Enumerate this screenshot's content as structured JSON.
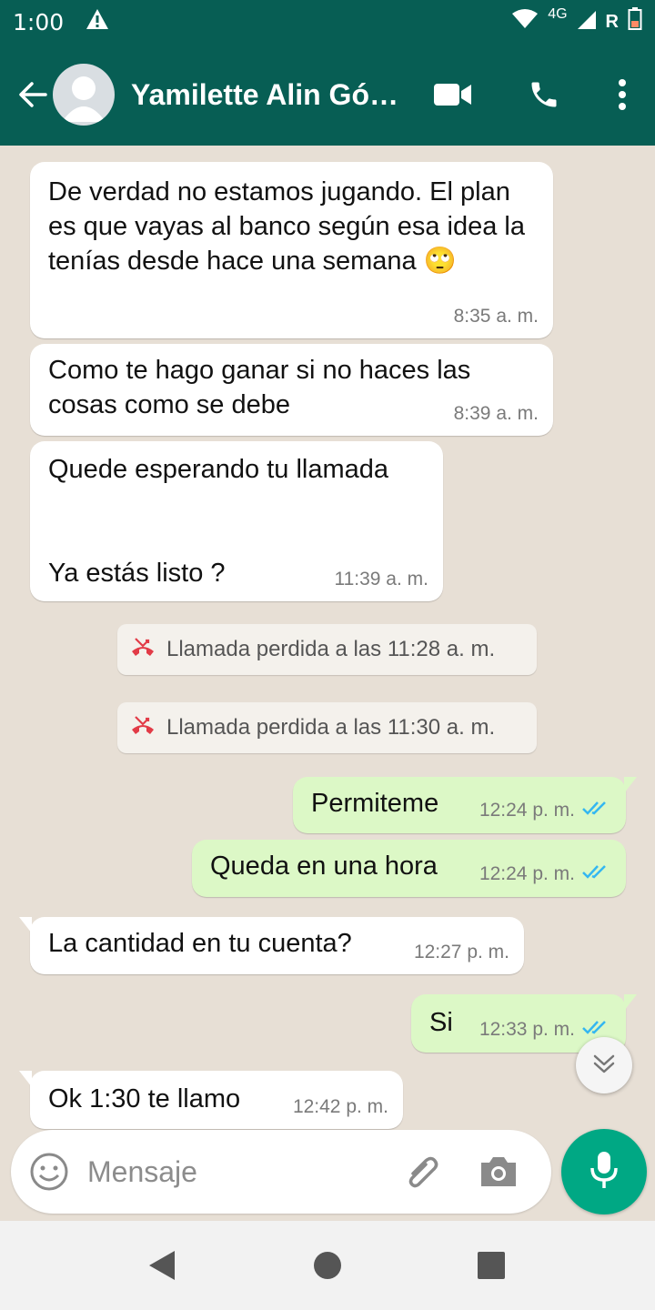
{
  "status_bar": {
    "time": "1:00",
    "network": "4G",
    "roaming": "R",
    "icons": [
      "warning-icon",
      "wifi-icon",
      "signal-icon",
      "battery-icon"
    ]
  },
  "header": {
    "contact_name": "Yamilette Alin Gó…",
    "icons": [
      "back-arrow-icon",
      "avatar",
      "video-call-icon",
      "voice-call-icon",
      "more-options-icon"
    ]
  },
  "messages": [
    {
      "direction": "in",
      "text": "De verdad no estamos jugando. El plan es que vayas al banco según esa idea la tenías desde hace una semana 🙄",
      "time": "8:35 a. m."
    },
    {
      "direction": "in",
      "text": "Como te hago ganar si no haces las cosas como se debe",
      "time": "8:39 a. m."
    },
    {
      "direction": "in",
      "text": "Quede esperando tu llamada\n\n\nYa estás listo ?",
      "time": "11:39 a. m."
    },
    {
      "direction": "system",
      "icon": "missed-call-icon",
      "text": "Llamada perdida a las 11:28 a. m."
    },
    {
      "direction": "system",
      "icon": "missed-call-icon",
      "text": "Llamada perdida a las 11:30 a. m."
    },
    {
      "direction": "out",
      "text": "Permiteme",
      "time": "12:24 p. m.",
      "status": "read"
    },
    {
      "direction": "out",
      "text": "Queda en una hora",
      "time": "12:24 p. m.",
      "status": "read"
    },
    {
      "direction": "in",
      "text": "La cantidad en tu cuenta?",
      "time": "12:27 p. m."
    },
    {
      "direction": "out",
      "text": "Si",
      "time": "12:33 p. m.",
      "status": "read"
    },
    {
      "direction": "in",
      "text": "Ok 1:30 te llamo",
      "time": "12:42 p. m."
    }
  ],
  "composer": {
    "placeholder": "Mensaje",
    "icons": [
      "emoji-icon",
      "attach-icon",
      "camera-icon",
      "mic-icon"
    ]
  },
  "colors": {
    "header": "#075e54",
    "chat_background": "#e7dfd5",
    "outgoing_bubble": "#dcf8c6",
    "incoming_bubble": "#ffffff",
    "mic_button": "#00a884",
    "read_ticks": "#34b7f1",
    "missed_call": "#e23b47"
  }
}
